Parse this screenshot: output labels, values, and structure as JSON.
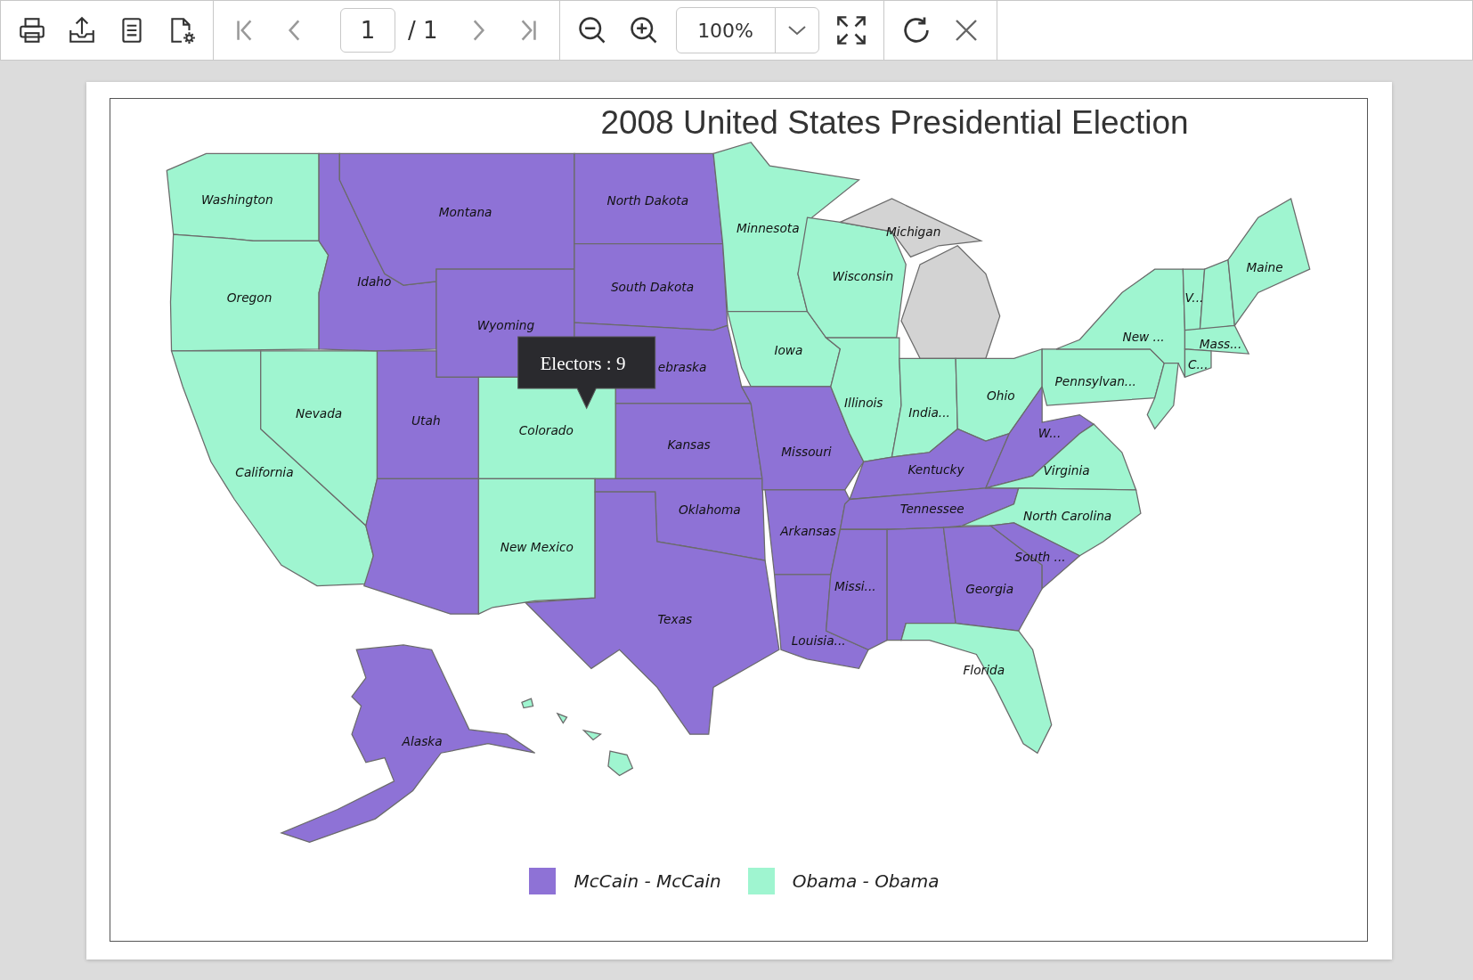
{
  "toolbar": {
    "page_input": {
      "value": "1"
    },
    "page_total": "/ 1",
    "zoom_value": "100%",
    "nav_buttons": [
      {
        "kind": "first",
        "disabled": true
      },
      {
        "kind": "prev",
        "disabled": true
      },
      {
        "kind": "next",
        "disabled": true
      },
      {
        "kind": "last",
        "disabled": true
      }
    ]
  },
  "report": {
    "title": "2008 United States Presidential Election",
    "states": [
      {
        "label": "Washington",
        "color": "#9ff5d0"
      },
      {
        "label": "Oregon",
        "color": "#9ff5d0"
      },
      {
        "label": "California",
        "color": "#9ff5d0"
      },
      {
        "label": "Nevada",
        "color": "#9ff5d0"
      },
      {
        "label": "Idaho",
        "color": "#8e72d6"
      },
      {
        "label": "Montana",
        "color": "#8e72d6"
      },
      {
        "label": "Wyoming",
        "color": "#8e72d6"
      },
      {
        "label": "Utah",
        "color": "#8e72d6"
      },
      {
        "color": "#8e72d6"
      },
      {
        "label": "Colorado",
        "color": "#9ff5d0"
      },
      {
        "label": "New Mexico",
        "color": "#9ff5d0"
      },
      {
        "label": "North Dakota",
        "color": "#8e72d6"
      },
      {
        "label": "South Dakota",
        "color": "#8e72d6"
      },
      {
        "label": "ebraska",
        "color": "#8e72d6"
      },
      {
        "label": "Kansas",
        "color": "#8e72d6"
      },
      {
        "label": "Oklahoma",
        "color": "#8e72d6"
      },
      {
        "label": "Texas",
        "color": "#8e72d6"
      },
      {
        "label": "Minnesota",
        "color": "#9ff5d0"
      },
      {
        "label": "Iowa",
        "color": "#9ff5d0"
      },
      {
        "label": "Missouri",
        "color": "#8e72d6"
      },
      {
        "label": "Arkansas",
        "color": "#8e72d6"
      },
      {
        "label": "Louisia...",
        "color": "#8e72d6"
      },
      {
        "label": "Wisconsin",
        "color": "#9ff5d0"
      },
      {
        "label": "Michigan",
        "color": "#d3d3d3"
      },
      {
        "label": "Illinois",
        "color": "#9ff5d0"
      },
      {
        "label": "India...",
        "color": "#9ff5d0"
      },
      {
        "label": "Ohio",
        "color": "#9ff5d0"
      },
      {
        "label": "Kentucky",
        "color": "#8e72d6"
      },
      {
        "label": "Tennessee",
        "color": "#8e72d6"
      },
      {
        "label": "Missi...",
        "color": "#8e72d6"
      },
      {
        "color": "#8e72d6"
      },
      {
        "label": "Georgia",
        "color": "#8e72d6"
      },
      {
        "label": "Florida",
        "color": "#9ff5d0"
      },
      {
        "label": "W...",
        "color": "#8e72d6"
      },
      {
        "label": "Virginia",
        "color": "#9ff5d0"
      },
      {
        "label": "North Carolina",
        "color": "#9ff5d0"
      },
      {
        "label": "South ...",
        "color": "#8e72d6"
      },
      {
        "label": "Pennsylvan...",
        "color": "#9ff5d0"
      },
      {
        "label": "New ...",
        "color": "#9ff5d0"
      },
      {
        "color": "#9ff5d0"
      },
      {
        "label": "V...",
        "color": "#9ff5d0"
      },
      {
        "color": "#9ff5d0"
      },
      {
        "label": "Maine",
        "color": "#9ff5d0"
      },
      {
        "label": "Mass...",
        "color": "#9ff5d0"
      },
      {
        "label": "C...",
        "color": "#9ff5d0"
      },
      {
        "label": "Alaska",
        "color": "#8e72d6"
      },
      {
        "color": "#9ff5d0"
      }
    ],
    "tooltip": "Electors : 9",
    "legend": [
      {
        "label": "McCain - McCain",
        "color": "#8e72d6"
      },
      {
        "label": "Obama - Obama",
        "color": "#9ff5d0"
      }
    ]
  }
}
